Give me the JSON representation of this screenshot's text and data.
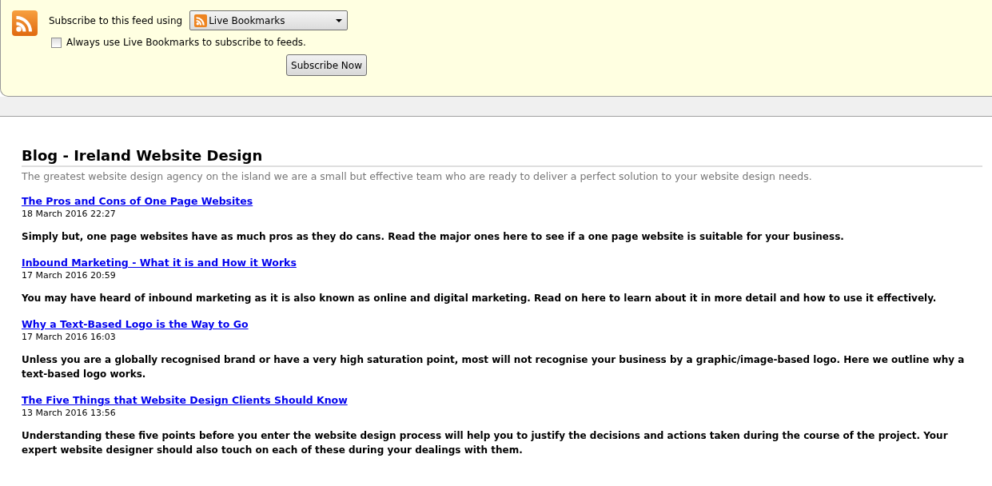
{
  "subscribe": {
    "label": "Subscribe to this feed using",
    "reader": "Live Bookmarks",
    "always_label": "Always use Live Bookmarks to subscribe to feeds.",
    "always_checked": false,
    "button": "Subscribe Now"
  },
  "blog": {
    "title": "Blog - Ireland Website Design",
    "subtitle": "The greatest website design agency on the island we are a small but effective team who are ready to deliver a perfect solution to your website design needs.",
    "entries": [
      {
        "title": "The Pros and Cons of One Page Websites",
        "date": "18 March 2016 22:27",
        "summary": "Simply but, one page websites have as much pros as they do cans. Read the major ones here to see if a one page website is suitable for your business."
      },
      {
        "title": "Inbound Marketing - What it is and How it Works",
        "date": "17 March 2016 20:59",
        "summary": "You may have heard of inbound marketing as it is also known as online and digital marketing. Read on here to learn about it in more detail and how to use it effectively."
      },
      {
        "title": "Why a Text-Based Logo is the Way to Go",
        "date": "17 March 2016 16:03",
        "summary": "Unless you are a globally recognised brand or have a very high saturation point, most will not recognise your business by a graphic/image-based logo. Here we outline why a text-based logo works."
      },
      {
        "title": "The Five Things that Website Design Clients Should Know",
        "date": "13 March 2016 13:56",
        "summary": "Understanding these five points before you enter the website design process will help you to justify the decisions and actions taken during the course of the project. Your expert website designer should also touch on each of these during your dealings with them."
      }
    ]
  }
}
